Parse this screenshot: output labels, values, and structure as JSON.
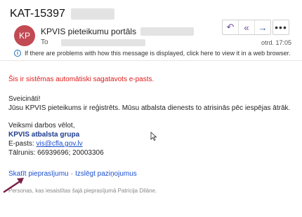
{
  "header": {
    "subject": "KAT-15397",
    "avatar_initials": "KP",
    "sender_name": "KPVIS pieteikumu portāls",
    "to_label": "To",
    "date": "otrd. 17:05",
    "info_text": "If there are problems with how this message is displayed, click here to view it in a web browser.",
    "avatar_color": "#c24a53"
  },
  "actions": {
    "reply_icon": "reply-icon",
    "reply_all_icon": "reply-all-icon",
    "forward_icon": "forward-icon",
    "more_icon": "more-icon"
  },
  "body": {
    "auto_notice": "Šis ir sistēmas automātiski sagatavots e-pasts.",
    "greeting": "Sveicināti!",
    "message": "Jūsu KPVIS pieteikums ir reģistrēts. Mūsu atbalsta dienests to atrisinās pēc iespējas ātrāk.",
    "sign_off": "Veiksmi darbos vēlot,",
    "team": "KPVIS atbalsta grupa",
    "email_label": "E-pasts:",
    "email": "vis@cfla.gov.lv",
    "phone": "Tālrunis: 66939696; 20003306"
  },
  "links": {
    "view_request": "Skatīt pieprasījumu",
    "separator": "·",
    "disable_notifications": "Izslēgt paziņojumus"
  },
  "footer": {
    "text": "Personas, kas iesaistītas šajā pieprasījumā Patricija Dilāne."
  }
}
